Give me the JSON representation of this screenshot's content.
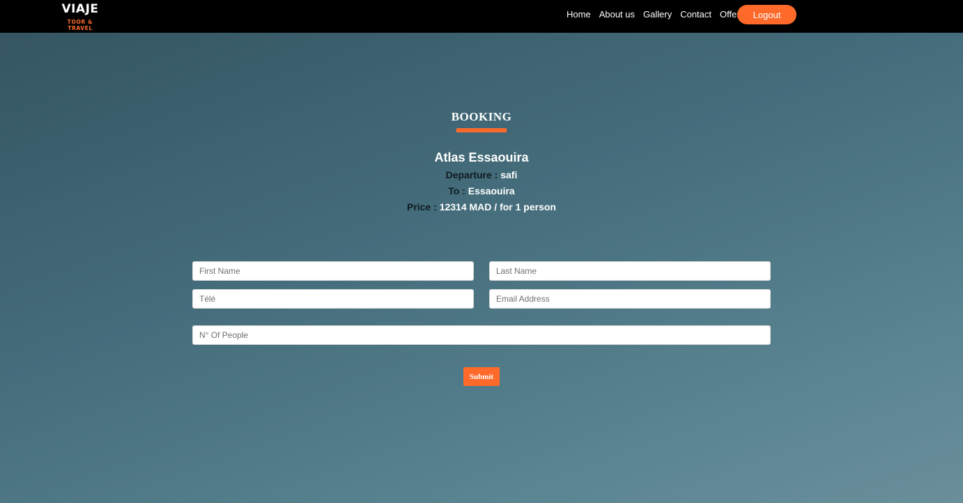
{
  "brand": {
    "name": "VIAJE",
    "tagline": "TOOR & TRAVEL"
  },
  "nav": {
    "links": [
      "Home",
      "About us",
      "Gallery",
      "Contact",
      "Offers"
    ],
    "logout_label": "Logout"
  },
  "booking": {
    "title": "BOOKING",
    "trip_name": "Atlas Essaouira",
    "departure_label": "Departure : ",
    "departure_value": "safi",
    "to_label": "To : ",
    "to_value": "Essaouira",
    "price_label": "Price : ",
    "price_value": "12314 MAD / for 1 person"
  },
  "form": {
    "first_name_placeholder": "First Name",
    "last_name_placeholder": "Last Name",
    "phone_placeholder": "Télé",
    "email_placeholder": "Email Address",
    "people_placeholder": "N° Of People",
    "submit_label": "Submit"
  },
  "colors": {
    "accent": "#ff6a2b",
    "navbar": "#000000"
  }
}
